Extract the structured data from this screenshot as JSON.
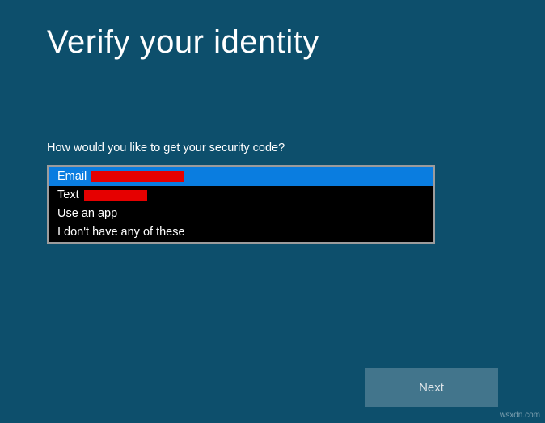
{
  "title": "Verify your identity",
  "prompt": "How would you like to get your security code?",
  "options": [
    {
      "label": "Email ",
      "redacted": true,
      "redact_class": "r1",
      "selected": true
    },
    {
      "label": "Text ",
      "redacted": true,
      "redact_class": "r2",
      "selected": false
    },
    {
      "label": "Use an app",
      "redacted": false,
      "selected": false
    },
    {
      "label": "I don't have any of these",
      "redacted": false,
      "selected": false
    }
  ],
  "next_button": "Next",
  "watermark": "wsxdn.com"
}
